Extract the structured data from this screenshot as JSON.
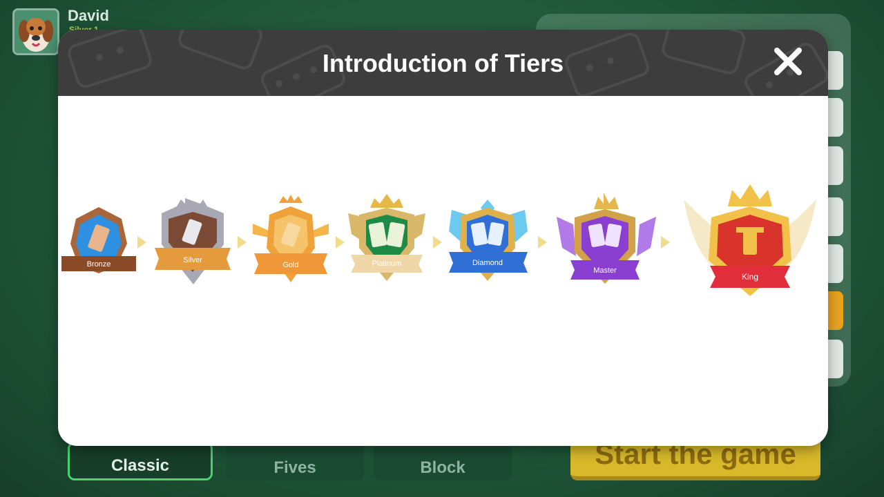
{
  "player": {
    "name": "David",
    "rank": "Silver 1"
  },
  "modal": {
    "title": "Introduction of Tiers",
    "close_icon": "close-icon"
  },
  "tiers": [
    {
      "name": "Bronze",
      "color": "#a8663a",
      "accent": "#2f8fe0"
    },
    {
      "name": "Silver",
      "color": "#a9a9b5",
      "accent": "#e59a3c"
    },
    {
      "name": "Gold",
      "color": "#f0a23a",
      "accent": "#f5b54a"
    },
    {
      "name": "Platinum",
      "color": "#d9b86a",
      "accent": "#1f8a45"
    },
    {
      "name": "Diamond",
      "color": "#2f6fd6",
      "accent": "#6cc9f0"
    },
    {
      "name": "Master",
      "color": "#8a3fd0",
      "accent": "#b27ae8"
    },
    {
      "name": "King",
      "color": "#d9342b",
      "accent": "#f2c14a"
    }
  ],
  "modes": [
    {
      "label": "Classic",
      "active": true
    },
    {
      "label": "Fives",
      "active": false
    },
    {
      "label": "Block",
      "active": false
    }
  ],
  "start_button": {
    "label": "Start the game"
  },
  "colors": {
    "header": "#3d3d3d",
    "modal_bg": "#ffffff",
    "arrow": "#f2dc8c",
    "table_green": "#1f5738"
  }
}
